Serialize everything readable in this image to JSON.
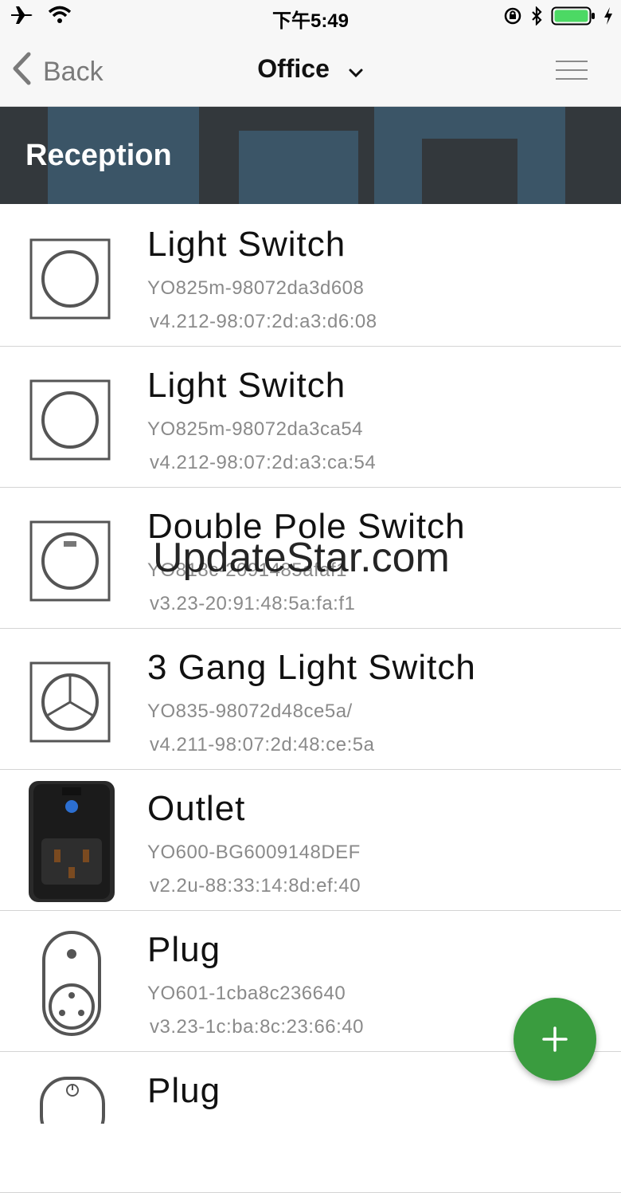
{
  "status_bar": {
    "time": "下午5:49",
    "icons": [
      "airplane-icon",
      "wifi-icon",
      "rotation-lock-icon",
      "bluetooth-icon",
      "battery-icon",
      "charging-icon"
    ]
  },
  "nav": {
    "back_label": "Back",
    "title": "Office",
    "menu_icon": "hamburger-menu-icon"
  },
  "section": {
    "title": "Reception"
  },
  "devices": [
    {
      "name": "Light Switch",
      "model": "YO825m-98072da3d608",
      "version": "v4.212-98:07:2d:a3:d6:08",
      "icon": "light-switch-icon"
    },
    {
      "name": "Light Switch",
      "model": "YO825m-98072da3ca54",
      "version": "v4.212-98:07:2d:a3:ca:54",
      "icon": "light-switch-icon"
    },
    {
      "name": "Double Pole Switch",
      "model": "YO818c-2091485afaf1",
      "version": "v3.23-20:91:48:5a:fa:f1",
      "icon": "double-pole-switch-icon"
    },
    {
      "name": "3 Gang Light Switch",
      "model": "YO835-98072d48ce5a/",
      "version": "v4.211-98:07:2d:48:ce:5a",
      "icon": "three-gang-switch-icon"
    },
    {
      "name": "Outlet",
      "model": "YO600-BG6009148DEF",
      "version": "v2.2u-88:33:14:8d:ef:40",
      "icon": "outlet-icon"
    },
    {
      "name": "Plug",
      "model": "YO601-1cba8c236640",
      "version": "v3.23-1c:ba:8c:23:66:40",
      "icon": "plug-icon"
    },
    {
      "name": "Plug",
      "model": "",
      "version": "",
      "icon": "plug-icon"
    }
  ],
  "watermark": "UpdateStar.com",
  "fab": {
    "icon": "plus-icon"
  },
  "colors": {
    "accent_green": "#3a9c3f",
    "banner": "#33383c",
    "text_secondary": "#8a8a8a"
  }
}
